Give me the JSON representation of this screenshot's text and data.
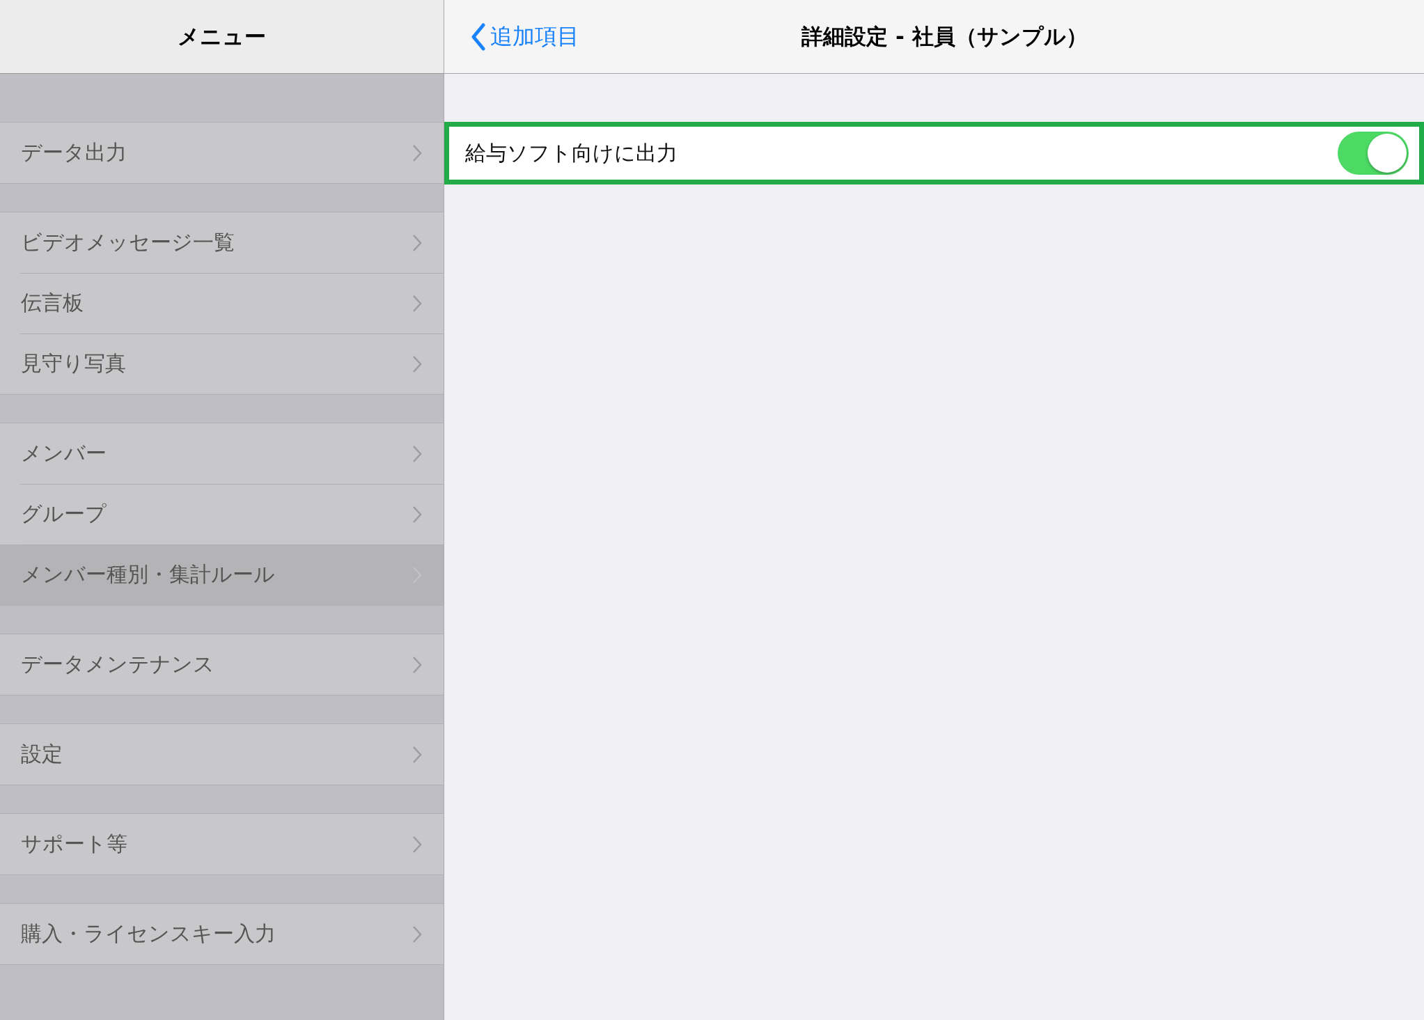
{
  "sidebar": {
    "title": "メニュー",
    "groups": [
      {
        "items": [
          {
            "label": "データ出力",
            "selected": false
          }
        ]
      },
      {
        "items": [
          {
            "label": "ビデオメッセージ一覧",
            "selected": false
          },
          {
            "label": "伝言板",
            "selected": false
          },
          {
            "label": "見守り写真",
            "selected": false
          }
        ]
      },
      {
        "items": [
          {
            "label": "メンバー",
            "selected": false
          },
          {
            "label": "グループ",
            "selected": false
          },
          {
            "label": "メンバー種別・集計ルール",
            "selected": true
          }
        ]
      },
      {
        "items": [
          {
            "label": "データメンテナンス",
            "selected": false
          }
        ]
      },
      {
        "items": [
          {
            "label": "設定",
            "selected": false
          }
        ]
      },
      {
        "items": [
          {
            "label": "サポート等",
            "selected": false
          }
        ]
      },
      {
        "items": [
          {
            "label": "購入・ライセンスキー入力",
            "selected": false
          }
        ]
      }
    ]
  },
  "detail": {
    "back_button": "追加項目",
    "title": "詳細設定 - 社員（サンプル）",
    "settings": [
      {
        "label": "給与ソフト向けに出力",
        "on": true,
        "highlighted": true
      }
    ]
  }
}
